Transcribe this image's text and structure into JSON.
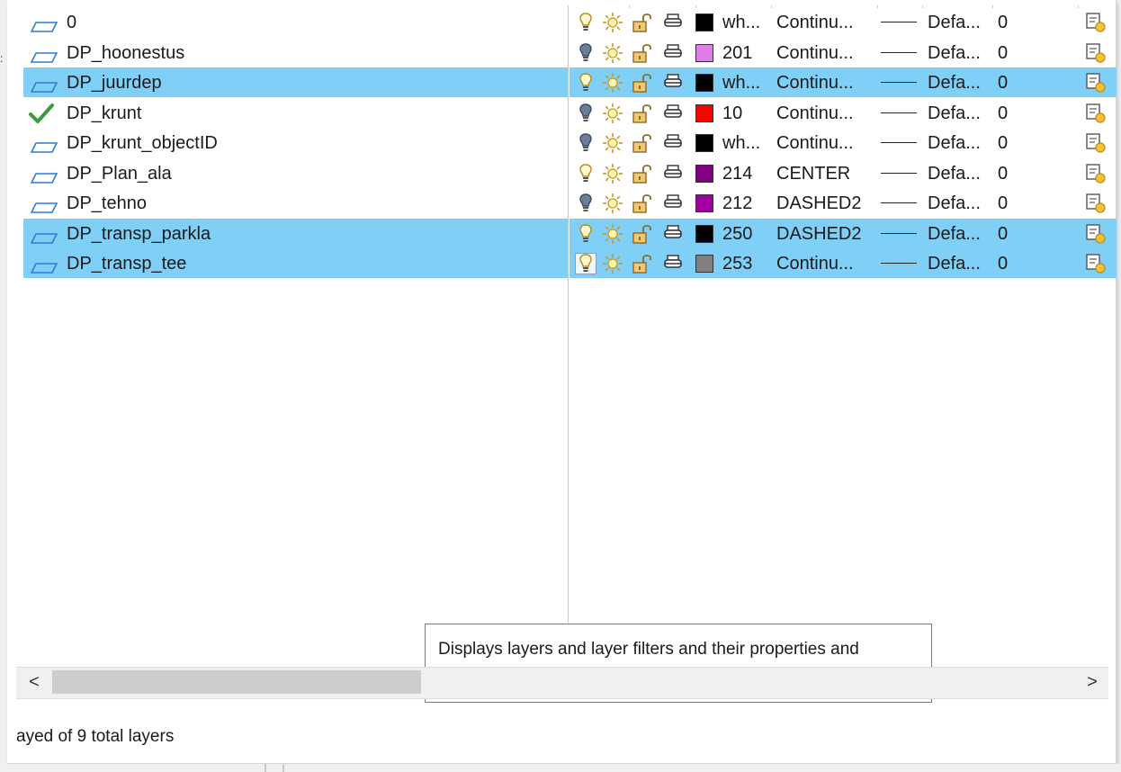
{
  "layers": [
    {
      "name": "0",
      "status": "layer",
      "selected": false,
      "on": true,
      "swatch": "#000000",
      "color_text": "wh...",
      "linetype": "Continu...",
      "lineweight": "Defa...",
      "transparency": "0"
    },
    {
      "name": "DP_hoonestus",
      "status": "layer",
      "selected": false,
      "on": false,
      "swatch": "#e07ee8",
      "color_text": "201",
      "linetype": "Continu...",
      "lineweight": "Defa...",
      "transparency": "0"
    },
    {
      "name": "DP_juurdep",
      "status": "layer",
      "selected": true,
      "on": true,
      "swatch": "#000000",
      "color_text": "wh...",
      "linetype": "Continu...",
      "lineweight": "Defa...",
      "transparency": "0"
    },
    {
      "name": "DP_krunt",
      "status": "current",
      "selected": false,
      "on": false,
      "swatch": "#ff0000",
      "color_text": "10",
      "linetype": "Continu...",
      "lineweight": "Defa...",
      "transparency": "0"
    },
    {
      "name": "DP_krunt_objectID",
      "status": "layer",
      "selected": false,
      "on": false,
      "swatch": "#000000",
      "color_text": "wh...",
      "linetype": "Continu...",
      "lineweight": "Defa...",
      "transparency": "0"
    },
    {
      "name": "DP_Plan_ala",
      "status": "layer",
      "selected": false,
      "on": true,
      "swatch": "#800080",
      "color_text": "214",
      "linetype": "CENTER",
      "lineweight": "Defa...",
      "transparency": "0"
    },
    {
      "name": "DP_tehno",
      "status": "layer",
      "selected": false,
      "on": false,
      "swatch": "#a000a0",
      "color_text": "212",
      "linetype": "DASHED2",
      "lineweight": "Defa...",
      "transparency": "0"
    },
    {
      "name": "DP_transp_parkla",
      "status": "layer",
      "selected": true,
      "on": true,
      "swatch": "#000000",
      "color_text": "250",
      "linetype": "DASHED2",
      "lineweight": "Defa...",
      "transparency": "0"
    },
    {
      "name": "DP_transp_tee",
      "status": "layer",
      "selected": true,
      "on": true,
      "focus": true,
      "swatch": "#808080",
      "color_text": "253",
      "linetype": "Continu...",
      "lineweight": "Defa...",
      "transparency": "0"
    }
  ],
  "tooltip": {
    "text": "Displays layers and layer filters and their properties and descriptions."
  },
  "status_bar": {
    "text": "ayed of 9 total layers"
  },
  "scrollbar": {
    "left_arrow": "<",
    "right_arrow": ">"
  },
  "colors": {
    "selection": "#7fcff6",
    "bulb_on": "#f2d24a",
    "bulb_off": "#6b7f99",
    "sun": "#e8c64a",
    "lock": "#d9a84a",
    "current_check": "#3b9b3b",
    "layer_icon": "#2e7bd6"
  },
  "icons": [
    "layer-icon",
    "current-layer-check-icon",
    "on-off-bulb-icon",
    "freeze-sun-icon",
    "lock-icon",
    "plot-icon",
    "new-vp-freeze-icon"
  ]
}
